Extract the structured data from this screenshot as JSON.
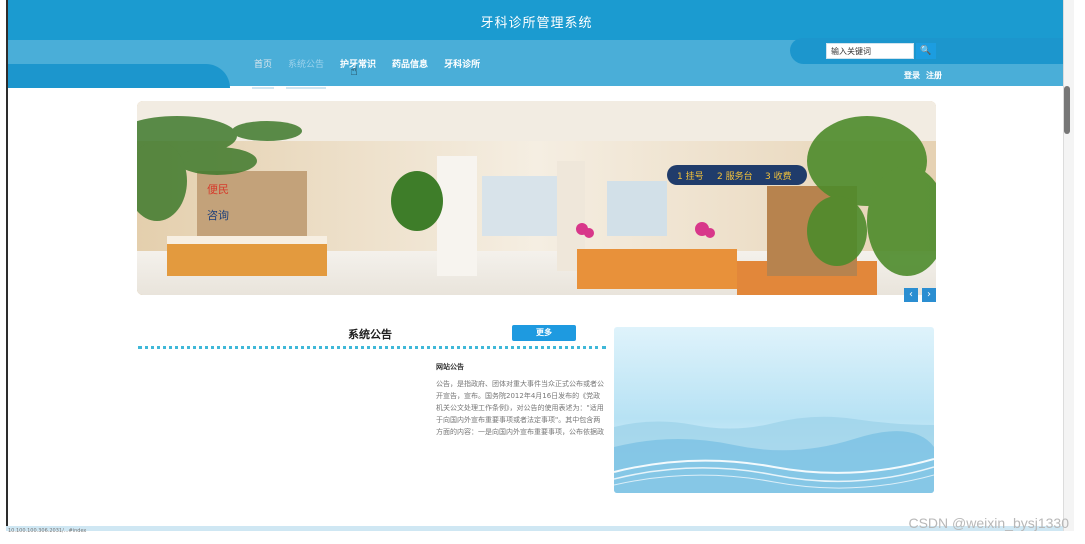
{
  "header": {
    "site_title": "牙科诊所管理系统"
  },
  "nav": {
    "items": [
      {
        "label": "首页",
        "state": "active"
      },
      {
        "label": "系统公告",
        "state": "dim"
      },
      {
        "label": "护牙常识",
        "state": "normal"
      },
      {
        "label": "药品信息",
        "state": "normal"
      },
      {
        "label": "牙科诊所",
        "state": "normal"
      }
    ]
  },
  "search": {
    "placeholder": "输入关键词",
    "button_icon": "search-icon"
  },
  "auth": {
    "login": "登录",
    "register": "注册"
  },
  "banner": {
    "signs": [
      "1 挂号",
      "2 服务台",
      "3 收费"
    ],
    "logo_text": "便民",
    "counter_sign": "咨询"
  },
  "notice": {
    "section_title": "系统公告",
    "more_label": "更多",
    "item_title": "网站公告",
    "item_text": "公告，是指政府、团体对重大事件当众正式公布或者公开宣告，宣布。国务院2012年4月16日发布的《党政机关公文处理工作条例》，对公告的使用表述为：\"适用于向国内外宣布重要事项或者法定事项\"。其中包含两方面的内容：一是向国内外宣布重要事项，公布依据政策、法令采取的重大行动等；二是向国内外宣布法定事项，公布依据法律规定告知国内外的有关重要规定和重大行动等。"
  },
  "watermark": "CSDN @weixin_bysj1330",
  "status_bar": "10.100.100.306.2031/...#index"
}
